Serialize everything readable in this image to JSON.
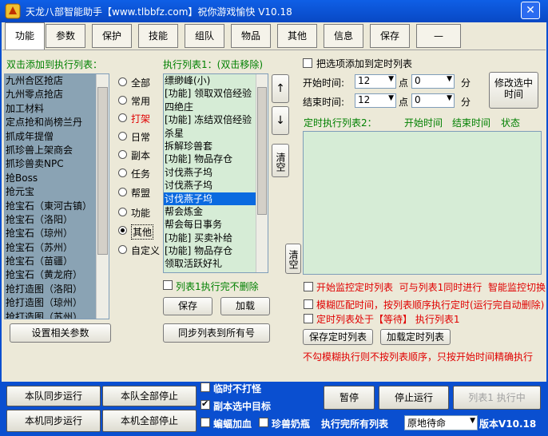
{
  "window": {
    "title": "天龙八部智能助手【www.tlbbfz.com】祝你游戏愉快 V10.18",
    "close": "✕"
  },
  "tabs": [
    "功能",
    "参数",
    "保护",
    "技能",
    "组队",
    "物品",
    "其他",
    "信息",
    "保存",
    "—"
  ],
  "left": {
    "header": "双击添加到执行列表：",
    "items": [
      "九州合区抢店",
      "九州零点抢店",
      "加工材料",
      "定点抢和尚榜兰丹",
      "抓成年提僧",
      "抓珍兽上架商会",
      "抓珍兽卖NPC",
      "抢Boss",
      "抢元宝",
      "抢宝石（東河古镇）",
      "抢宝石（洛阳）",
      "抢宝石（琼州）",
      "抢宝石（苏州）",
      "抢宝石（苗疆）",
      "抢宝石（黄龙府）",
      "抢打造图（洛阳）",
      "抢打造图（琼州）",
      "抢打造图（苏州）"
    ],
    "settings_button": "设置相关参数"
  },
  "categories": {
    "items": [
      "全部",
      "常用",
      "打架",
      "日常",
      "副本",
      "任务",
      "帮盟",
      "功能",
      "其他",
      "自定义"
    ],
    "selected": "其他"
  },
  "exec": {
    "header": "执行列表1：(双击移除)",
    "items": [
      "缥缈峰(小)",
      "[功能] 领取双倍经验",
      "四绝庄",
      "[功能] 冻结双倍经验",
      "杀星",
      "拆解珍兽套",
      "[功能] 物品存仓",
      "讨伐燕子坞",
      "讨伐燕子坞",
      "讨伐燕子坞",
      "帮会炼金",
      "帮会每日事务",
      "[功能] 买卖补给",
      "[功能] 物品存仓",
      "领取活跃好礼"
    ],
    "selected_index": 9,
    "up": "↑",
    "down": "↓",
    "clear": "清空",
    "no_delete": "列表1执行完不删除",
    "save": "保存",
    "load": "加载",
    "sync": "同步列表到所有号"
  },
  "timer": {
    "add_label": "把选项添加到定时列表",
    "start_label": "开始时间:",
    "end_label": "结束时间:",
    "start_hour": "12",
    "start_min": "0",
    "end_hour": "12",
    "end_min": "0",
    "point": "点",
    "minute": "分",
    "modify": "修改选中时间",
    "list_header": "定时执行列表2：",
    "col_start": "开始时间",
    "col_end": "结束时间",
    "col_status": "状态",
    "clear": "清空"
  },
  "options": {
    "monitor": "开始监控定时列表",
    "monitor_note": "可与列表1同时进行",
    "smart": "智能监控切换",
    "fuzzy": "模糊匹配时间，按列表顺序执行定时(运行完自动删除)",
    "wait": "定时列表处于【等待】 执行列表1",
    "save_timer": "保存定时列表",
    "load_timer": "加载定时列表",
    "warn": "不勾模糊执行则不按列表顺序，只按开始时间精确执行"
  },
  "bottom": {
    "team_sync": "本队同步运行",
    "team_stop": "本队全部停止",
    "local_sync": "本机同步运行",
    "local_stop": "本机全部停止",
    "temp_noattack": "临时不打怪",
    "dungeon_target": "副本选中目标",
    "bat_heal": "蝙蝠加血",
    "pet_milk": "珍兽奶瓶",
    "pause": "暂停",
    "stop": "停止运行",
    "running": "列表1 执行中",
    "after_exec": "执行完所有列表",
    "after_value": "原地待命",
    "version": "版本V10.18"
  }
}
